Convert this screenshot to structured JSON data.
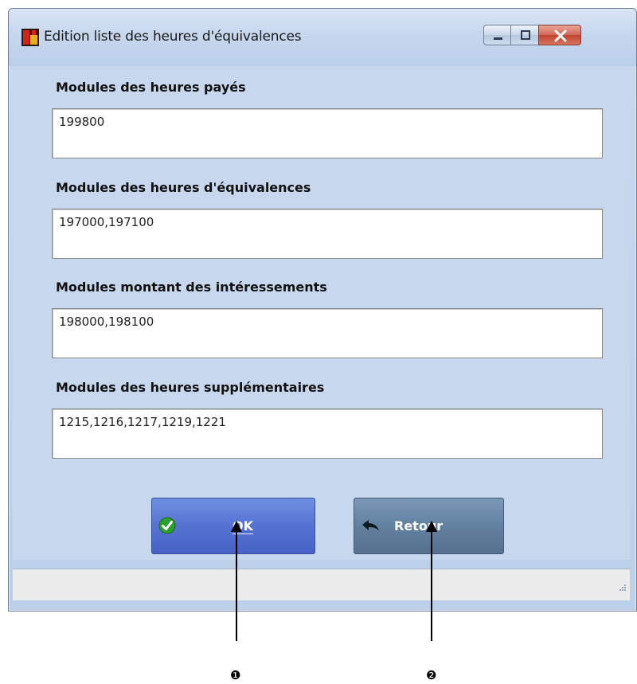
{
  "window": {
    "title": "Edition liste des heures d'équivalences",
    "app_icon": "app-logo-icon",
    "controls": [
      "minimize-icon",
      "maximize-icon",
      "close-icon"
    ]
  },
  "fields": [
    {
      "label": "Modules des heures payés",
      "value": "199800"
    },
    {
      "label": "Modules des heures d'équivalences",
      "value": "197000,197100"
    },
    {
      "label": "Modules montant des intéressements",
      "value": "198000,198100"
    },
    {
      "label": "Modules des heures supplémentaires",
      "value": "1215,1216,1217,1219,1221"
    }
  ],
  "buttons": {
    "ok": {
      "label": "OK",
      "icon": "checkmark-icon",
      "color": "#5572d2"
    },
    "back": {
      "label": "Retour",
      "icon": "back-arrow-icon",
      "color": "#62809f"
    }
  },
  "annotations": {
    "marker_1": "❶",
    "marker_2": "❷"
  }
}
